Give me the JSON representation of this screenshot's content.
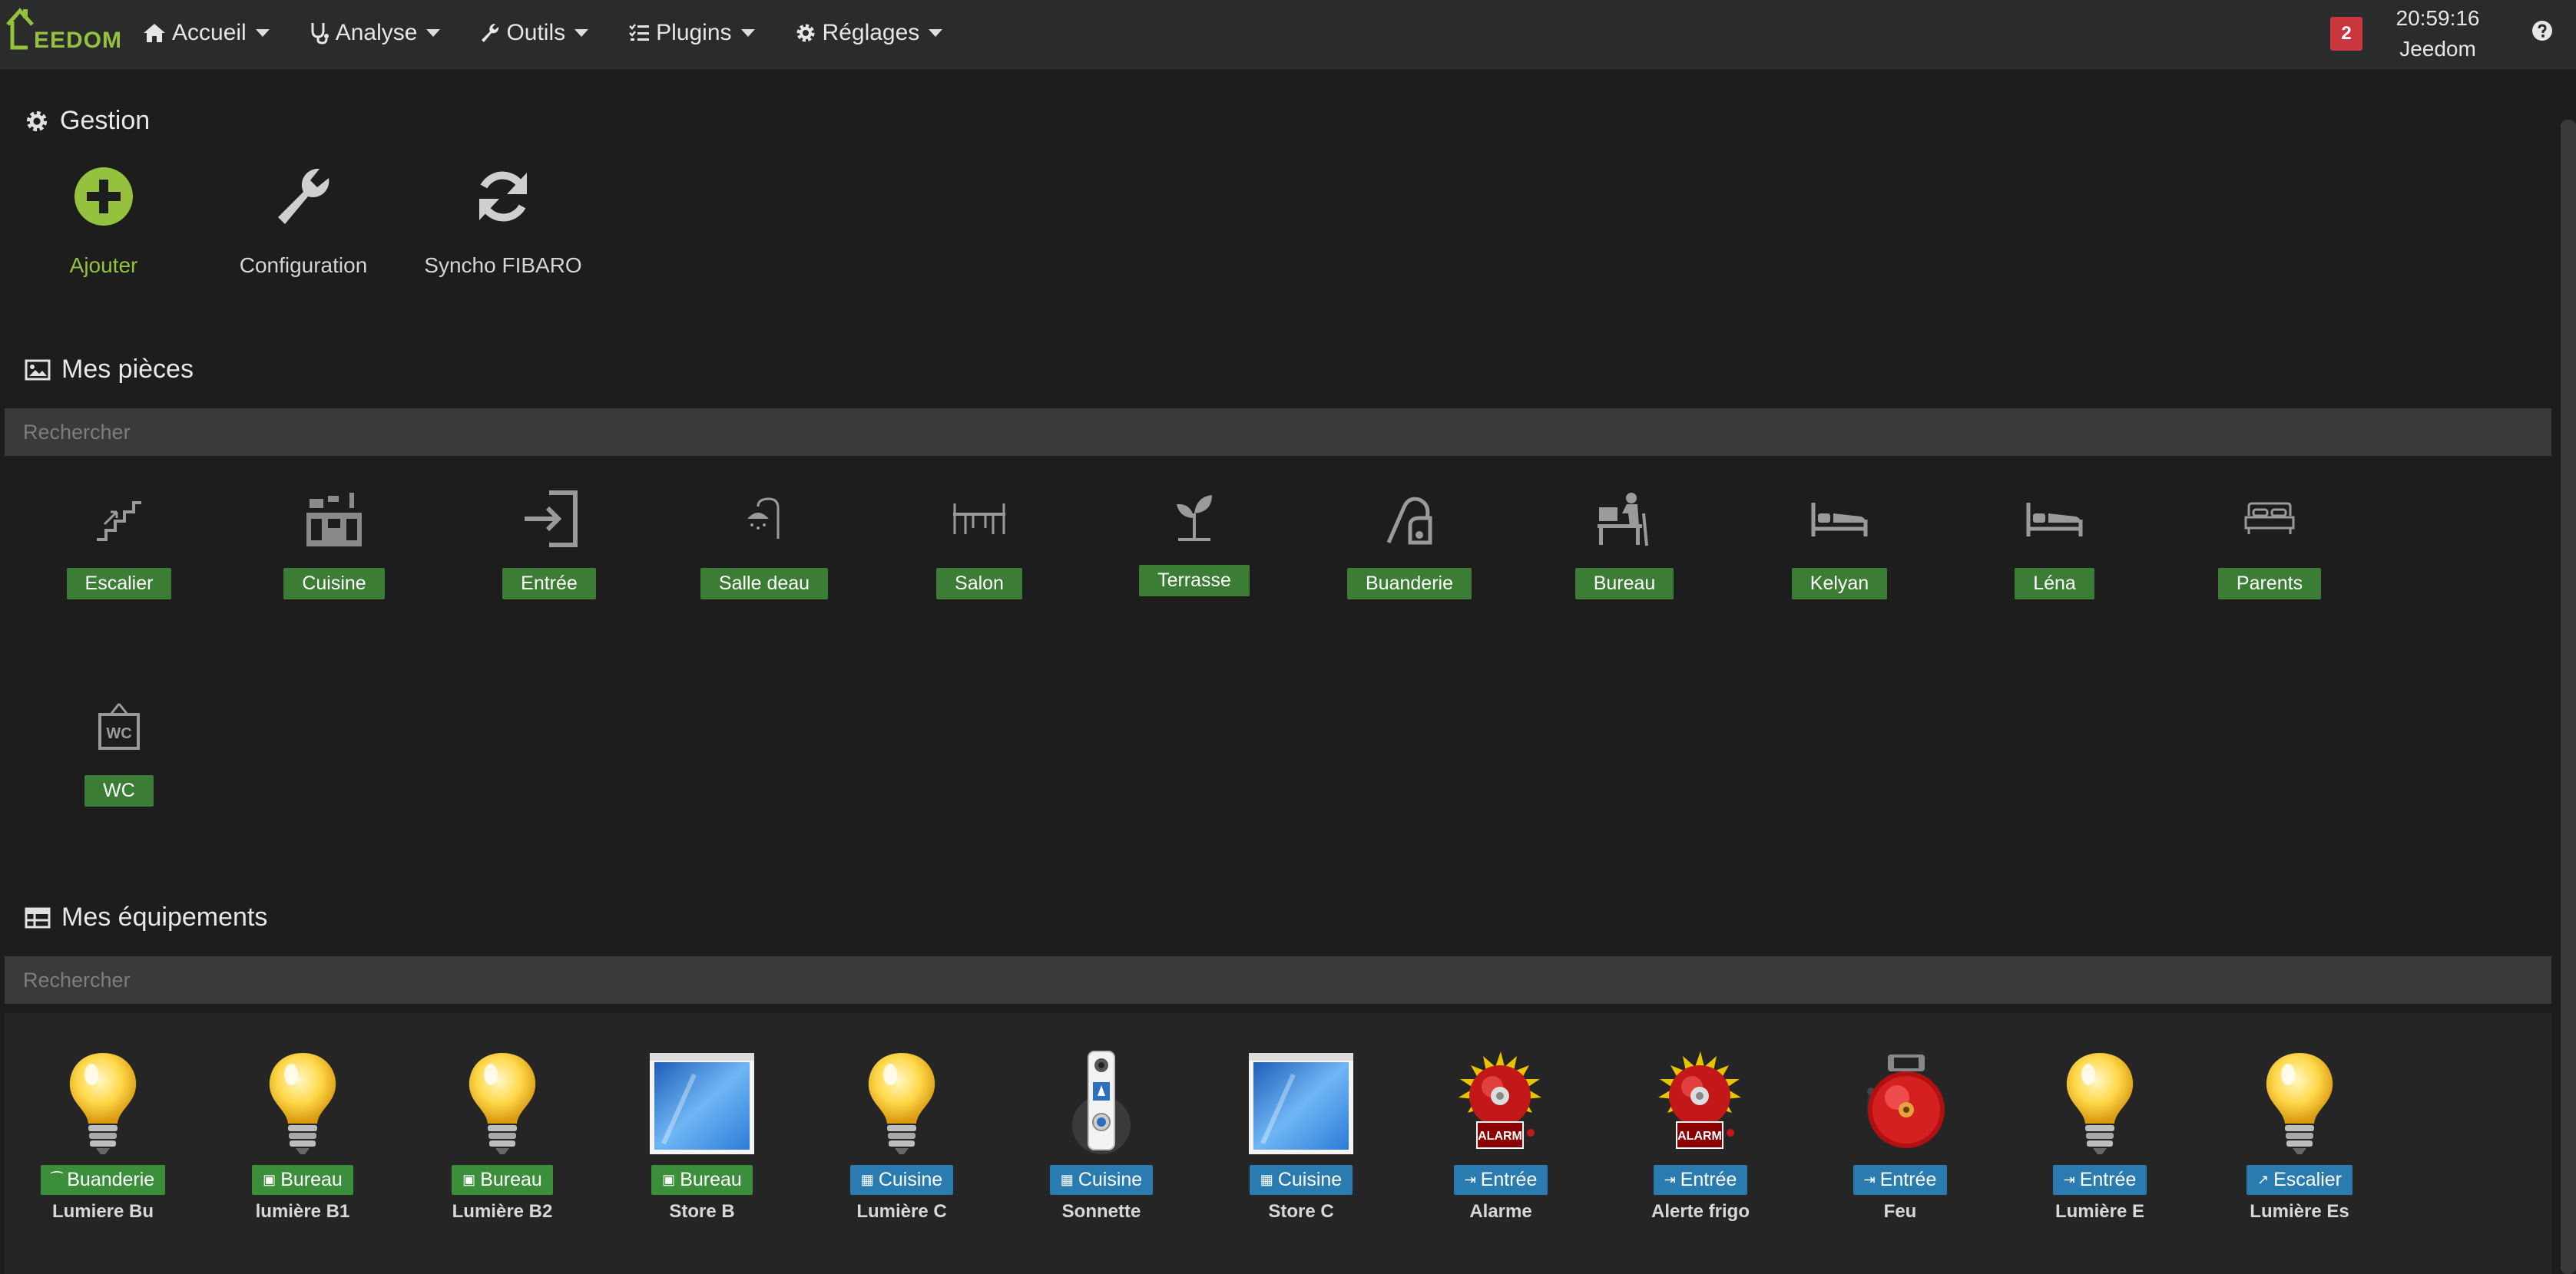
{
  "app": {
    "logo_text": "EEDOM"
  },
  "nav": [
    {
      "label": "Accueil",
      "icon": "home-icon"
    },
    {
      "label": "Analyse",
      "icon": "stethoscope-icon"
    },
    {
      "label": "Outils",
      "icon": "wrench-icon"
    },
    {
      "label": "Plugins",
      "icon": "list-icon"
    },
    {
      "label": "Réglages",
      "icon": "gear-icon"
    }
  ],
  "header": {
    "notification_count": "2",
    "time": "20:59:16",
    "user": "Jeedom"
  },
  "gestion": {
    "title": "Gestion",
    "actions": [
      {
        "label": "Ajouter",
        "icon": "plus-circle-icon"
      },
      {
        "label": "Configuration",
        "icon": "wrench-icon"
      },
      {
        "label": "Syncho FIBARO",
        "icon": "refresh-icon"
      }
    ]
  },
  "rooms": {
    "title": "Mes pièces",
    "search_placeholder": "Rechercher",
    "items": [
      {
        "label": "Escalier",
        "icon": "stairs-icon"
      },
      {
        "label": "Cuisine",
        "icon": "kitchen-icon"
      },
      {
        "label": "Entrée",
        "icon": "sign-in-icon"
      },
      {
        "label": "Salle deau",
        "icon": "shower-icon"
      },
      {
        "label": "Salon",
        "icon": "table-icon"
      },
      {
        "label": "Terrasse",
        "icon": "plant-icon"
      },
      {
        "label": "Buanderie",
        "icon": "vacuum-icon"
      },
      {
        "label": "Bureau",
        "icon": "desk-icon"
      },
      {
        "label": "Kelyan",
        "icon": "bed-icon"
      },
      {
        "label": "Léna",
        "icon": "bed-icon"
      },
      {
        "label": "Parents",
        "icon": "double-bed-icon"
      },
      {
        "label": "WC",
        "icon": "wc-icon"
      }
    ]
  },
  "equipments": {
    "title": "Mes équipements",
    "search_placeholder": "Rechercher",
    "items": [
      {
        "room": "Buanderie",
        "name": "Lumiere Bu",
        "type": "bulb",
        "tag_color": "green",
        "tag_icon": "vacuum-icon"
      },
      {
        "room": "Bureau",
        "name": "lumière B1",
        "type": "bulb",
        "tag_color": "green",
        "tag_icon": "desk-icon"
      },
      {
        "room": "Bureau",
        "name": "Lumière B2",
        "type": "bulb",
        "tag_color": "green",
        "tag_icon": "desk-icon"
      },
      {
        "room": "Bureau",
        "name": "Store B",
        "type": "window",
        "tag_color": "green",
        "tag_icon": "desk-icon"
      },
      {
        "room": "Cuisine",
        "name": "Lumière C",
        "type": "bulb",
        "tag_color": "blue",
        "tag_icon": "kitchen-icon"
      },
      {
        "room": "Cuisine",
        "name": "Sonnette",
        "type": "doorbell",
        "tag_color": "blue",
        "tag_icon": "kitchen-icon"
      },
      {
        "room": "Cuisine",
        "name": "Store C",
        "type": "window",
        "tag_color": "blue",
        "tag_icon": "kitchen-icon"
      },
      {
        "room": "Entrée",
        "name": "Alarme",
        "type": "alarm",
        "tag_color": "blue",
        "tag_icon": "sign-in-icon"
      },
      {
        "room": "Entrée",
        "name": "Alerte frigo",
        "type": "alarm",
        "tag_color": "blue",
        "tag_icon": "sign-in-icon"
      },
      {
        "room": "Entrée",
        "name": "Feu",
        "type": "siren",
        "tag_color": "blue",
        "tag_icon": "sign-in-icon"
      },
      {
        "room": "Entrée",
        "name": "Lumière E",
        "type": "bulb",
        "tag_color": "blue",
        "tag_icon": "sign-in-icon"
      },
      {
        "room": "Escalier",
        "name": "Lumière Es",
        "type": "bulb",
        "tag_color": "blue",
        "tag_icon": "stairs-icon"
      }
    ],
    "alarm_text": "ALARM"
  },
  "colors": {
    "accent": "#94c23e",
    "room_tag": "#3b7d34",
    "equip_green": "#3b8f3b",
    "equip_blue": "#2a7bb0",
    "badge": "#c9363d"
  }
}
